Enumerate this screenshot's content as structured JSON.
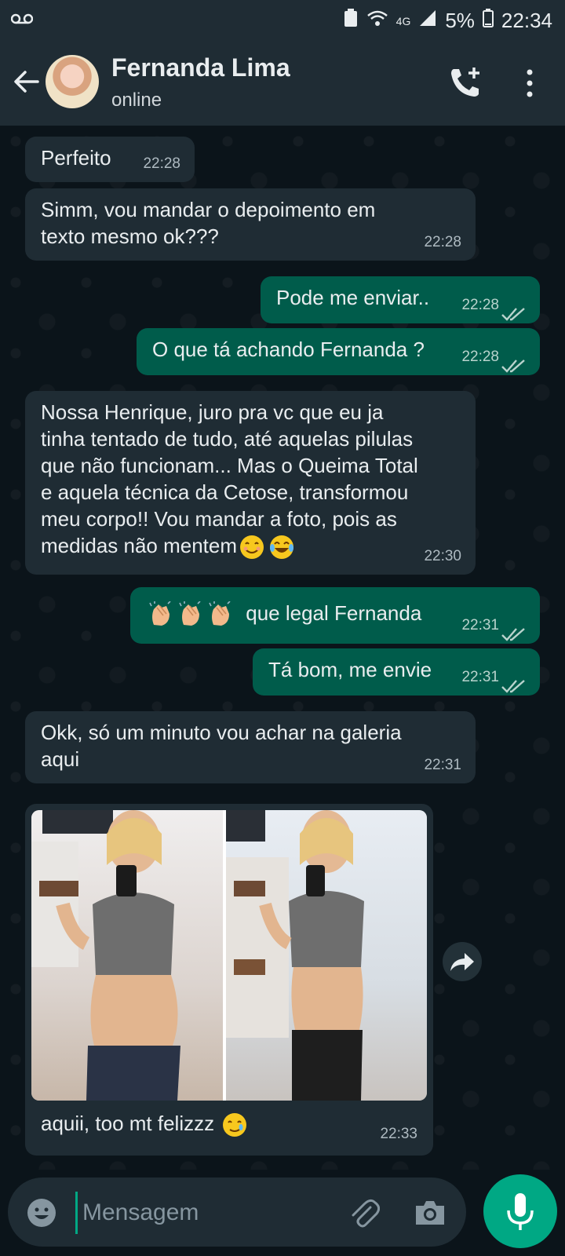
{
  "status_bar": {
    "voicemail_icon": "voicemail-icon",
    "network": "4G",
    "battery": "5%",
    "time": "22:34"
  },
  "header": {
    "contact_name": "Fernanda Lima",
    "presence": "online"
  },
  "messages": [
    {
      "direction": "in",
      "text": "Perfeito",
      "time": "22:28"
    },
    {
      "direction": "in",
      "text": "Simm, vou mandar o depoimento em\ntexto mesmo ok???",
      "time": "22:28"
    },
    {
      "direction": "out",
      "text": "Pode me enviar..",
      "time": "22:28",
      "status": "read"
    },
    {
      "direction": "out",
      "text": "O que tá achando Fernanda ?",
      "time": "22:28",
      "status": "read"
    },
    {
      "direction": "in",
      "text": "Nossa Henrique, juro pra vc que eu ja\ntinha tentado de tudo, até aquelas pilulas\nque não funcionam... Mas o Queima Total\ne aquela técnica da Cetose, transformou\nmeu corpo!! Vou mandar a foto, pois as\nmedidas não mentem",
      "time": "22:30",
      "emojis": [
        "smiling-face-emoji",
        "tears-of-joy-emoji"
      ]
    },
    {
      "direction": "out",
      "text": "que legal Fernanda",
      "time": "22:31",
      "status": "read",
      "emojis": [
        "clapping-hands-emoji",
        "clapping-hands-emoji",
        "clapping-hands-emoji"
      ]
    },
    {
      "direction": "out",
      "text": "Tá bom, me envie",
      "time": "22:31",
      "status": "read"
    },
    {
      "direction": "in",
      "text": "Okk, só um minuto vou achar na galeria\naqui",
      "time": "22:31"
    },
    {
      "direction": "in",
      "type": "image",
      "caption": "aquii, too mt felizzz",
      "time": "22:33",
      "emojis": [
        "smiling-face-with-tear-emoji"
      ]
    }
  ],
  "composer": {
    "placeholder": "Mensagem"
  },
  "colors": {
    "incoming_bubble": "#1f2c34",
    "outgoing_bubble": "#005c4b",
    "accent": "#00a884",
    "read_ticks": "#b9d3cd"
  }
}
